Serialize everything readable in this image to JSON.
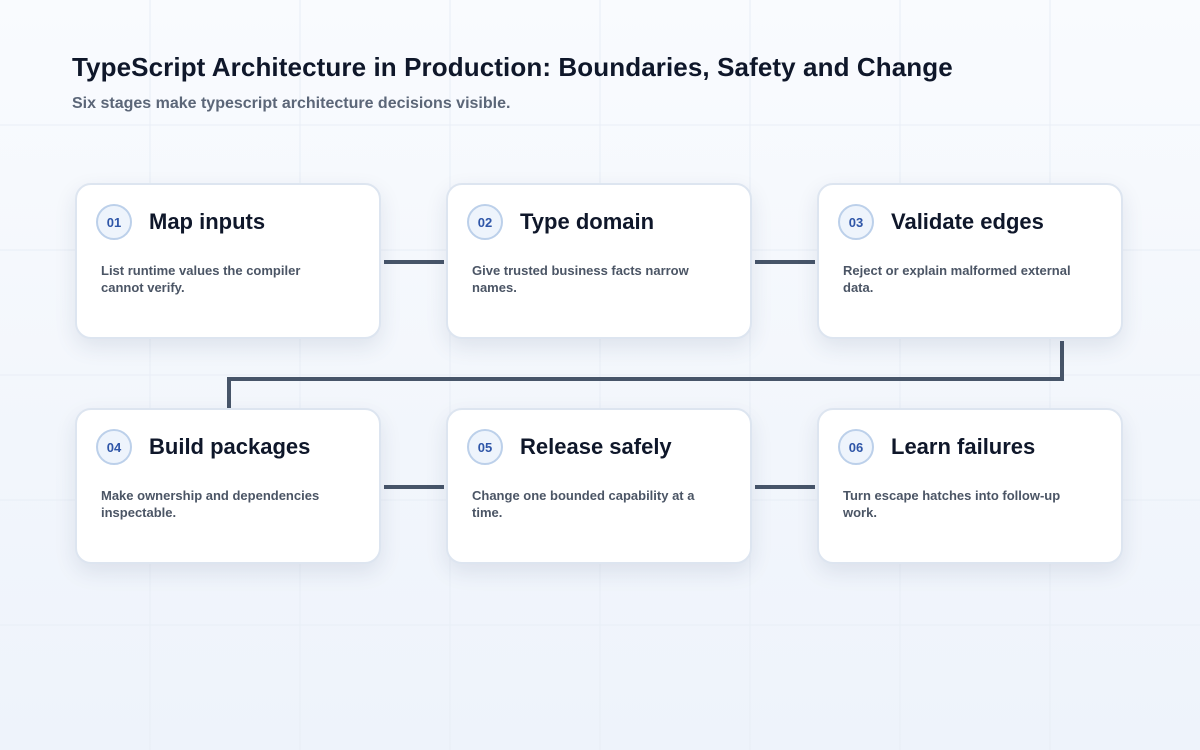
{
  "header": {
    "title": "TypeScript Architecture in Production: Boundaries, Safety and Change",
    "subtitle": "Six stages make typescript architecture decisions visible."
  },
  "colors": {
    "connector": "#475569",
    "badge_text": "#2f56a8",
    "badge_border": "#bcd0ea",
    "card_border": "#dde5f0"
  },
  "steps": [
    {
      "number": "01",
      "title": "Map inputs",
      "description": "List runtime values the compiler cannot verify."
    },
    {
      "number": "02",
      "title": "Type domain",
      "description": "Give trusted business facts narrow names."
    },
    {
      "number": "03",
      "title": "Validate edges",
      "description": "Reject or explain malformed external data."
    },
    {
      "number": "04",
      "title": "Build packages",
      "description": "Make ownership and dependencies inspectable."
    },
    {
      "number": "05",
      "title": "Release safely",
      "description": "Change one bounded capability at a time."
    },
    {
      "number": "06",
      "title": "Learn failures",
      "description": "Turn escape hatches into follow-up work."
    }
  ]
}
